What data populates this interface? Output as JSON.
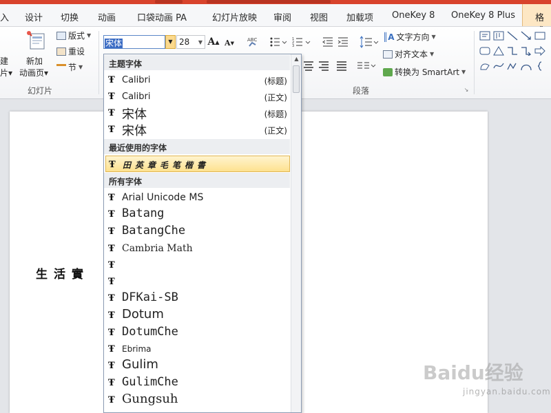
{
  "tabs": [
    {
      "label": "入"
    },
    {
      "label": "设计"
    },
    {
      "label": "切换"
    },
    {
      "label": "动画"
    },
    {
      "label": "口袋动画 PA"
    },
    {
      "label": "幻灯片放映"
    },
    {
      "label": "审阅"
    },
    {
      "label": "视图"
    },
    {
      "label": "加载项"
    },
    {
      "label": "OneKey 8"
    },
    {
      "label": "OneKey 8 Plus"
    },
    {
      "label": "格式"
    }
  ],
  "ribbon": {
    "slides_group": {
      "new_slide_cut_top": "建",
      "new_slide_cut_bottom": "片▾",
      "new_anim_page_top": "新加",
      "new_anim_page_bottom": "动画页▾",
      "layout": "版式",
      "reset": "重设",
      "section": "节",
      "group_label": "幻灯片"
    },
    "font_group": {
      "font_name": "宋体",
      "font_size": "28"
    },
    "paragraph_group": {
      "text_direction": "文字方向",
      "align_text": "对齐文本",
      "convert_smartart": "转换为 SmartArt",
      "group_label": "段落"
    }
  },
  "dropdown": {
    "theme_header": "主题字体",
    "theme_fonts": [
      {
        "name": "Calibri",
        "tag": "(标题)"
      },
      {
        "name": "Calibri",
        "tag": "(正文)"
      },
      {
        "name": "宋体",
        "tag": "(标题)"
      },
      {
        "name": "宋体",
        "tag": "(正文)"
      }
    ],
    "recent_header": "最近使用的字体",
    "recent_fonts": [
      {
        "name": "田英章毛笔楷書"
      }
    ],
    "all_header": "所有字体",
    "all_fonts": [
      {
        "name": "Arial Unicode MS"
      },
      {
        "name": "Batang"
      },
      {
        "name": "BatangChe"
      },
      {
        "name": "Cambria Math"
      },
      {
        "name": ""
      },
      {
        "name": ""
      },
      {
        "name": "DFKai-SB"
      },
      {
        "name": "Dotum"
      },
      {
        "name": "DotumChe"
      },
      {
        "name": "Ebrima"
      },
      {
        "name": "Gulim"
      },
      {
        "name": "GulimChe"
      },
      {
        "name": "Gungsuh"
      }
    ]
  },
  "slide": {
    "text": "生活實"
  },
  "watermark": {
    "main": "Baidu经验",
    "sub": "jingyan.baidu.com"
  }
}
